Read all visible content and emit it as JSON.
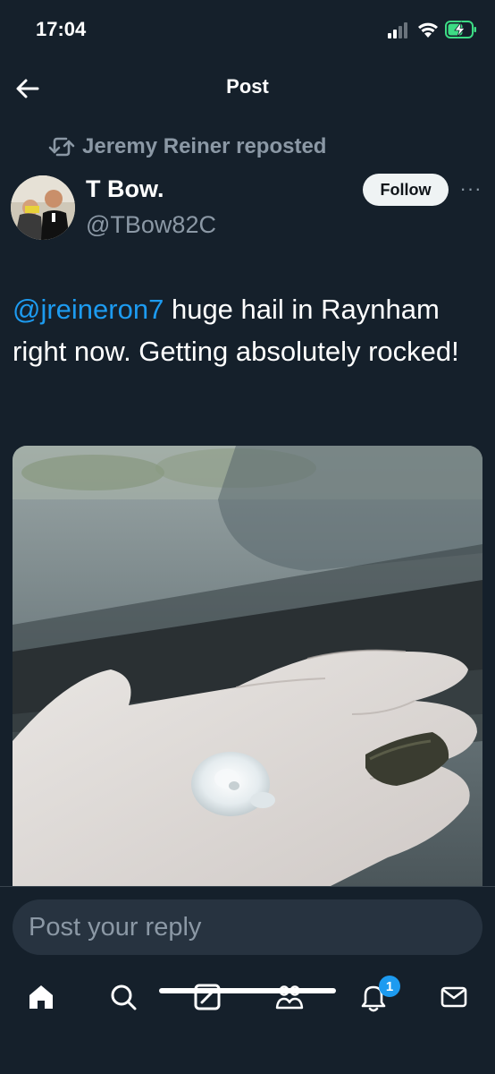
{
  "status_bar": {
    "time": "17:04"
  },
  "header": {
    "title": "Post",
    "back_icon": "arrow-left-icon"
  },
  "repost": {
    "text": "Jeremy Reiner reposted",
    "icon": "repost-icon"
  },
  "author": {
    "name": "T Bow.",
    "handle": "@TBow82C",
    "follow_label": "Follow",
    "more_label": "···"
  },
  "tweet": {
    "mention": "@jreineron7",
    "body": " huge hail in Raynham right now. Getting absolutely rocked!"
  },
  "media": {
    "icon": "photo-hailstone-in-hand"
  },
  "reply": {
    "placeholder": "Post your reply"
  },
  "bottom_nav": {
    "items": [
      "home-icon",
      "search-icon",
      "grok-icon",
      "communities-icon",
      "notifications-icon",
      "messages-icon"
    ],
    "notification_count": "1"
  },
  "colors": {
    "background": "#15202b",
    "accent": "#1d9bf0",
    "muted": "#8b98a5"
  }
}
